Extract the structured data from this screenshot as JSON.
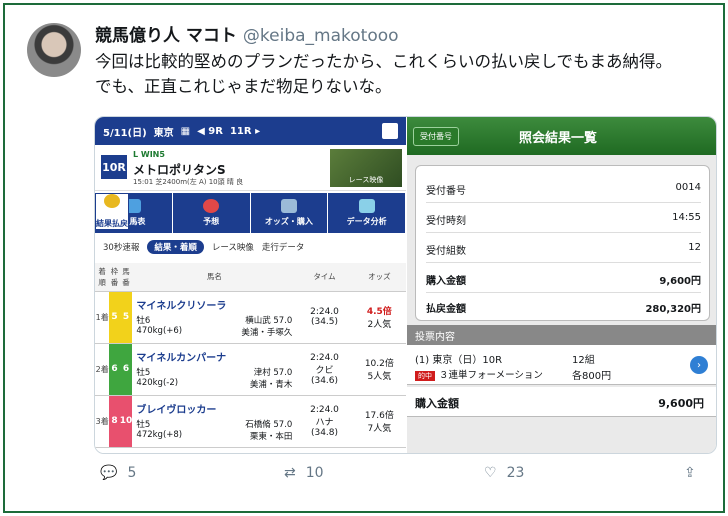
{
  "tweet": {
    "name": "競馬億り人 マコト",
    "handle": "@keiba_makotooo",
    "text_line1": "今回は比較的堅めのプランだったから、これくらいの払い戻しでもまあ納得。",
    "text_line2": "でも、正直これじゃまだ物足りないな。",
    "replies": "5",
    "retweets": "10",
    "likes": "23"
  },
  "left_panel": {
    "date": "5/11(日)",
    "venue": "東京",
    "race_prev": "◀ 9R",
    "race_next": "11R ▸",
    "race_no": "10R",
    "win5": "L  WIN5",
    "race_name": "メトロポリタンS",
    "race_sub": "15:01 芝2400m(左 A) 10頭 晴 良",
    "video_label": "レース映像",
    "icons": [
      "出馬表",
      "予想",
      "オッズ・購入",
      "データ分析",
      "結果払戻"
    ],
    "tabs": [
      "30秒速報",
      "結果・着順",
      "レース映像",
      "走行データ"
    ],
    "headers": [
      "着順",
      "枠番",
      "馬番",
      "馬名",
      "タイム",
      "オッズ"
    ],
    "rows": [
      {
        "fin": "1着",
        "waku": "5",
        "uma": "5",
        "name": "マイネルクリソーラ",
        "sex": "牡6",
        "jockey": "横山武 57.0",
        "weight": "470kg(+6)",
        "trainer": "美浦・手塚久",
        "time": "2:24.0",
        "margin": "",
        "last": "(34.5)",
        "odds": "4.5倍",
        "pop": "2人気",
        "color": "#f2d21b"
      },
      {
        "fin": "2着",
        "waku": "6",
        "uma": "6",
        "name": "マイネルカンパーナ",
        "sex": "牡5",
        "jockey": "津村 57.0",
        "weight": "420kg(-2)",
        "trainer": "美浦・青木",
        "time": "2:24.0",
        "margin": "クビ",
        "last": "(34.6)",
        "odds": "10.2倍",
        "pop": "5人気",
        "color": "#3fa63f"
      },
      {
        "fin": "3着",
        "waku": "8",
        "uma": "10",
        "name": "ブレイヴロッカー",
        "sex": "牡5",
        "jockey": "石橋脩 57.0",
        "weight": "472kg(+8)",
        "trainer": "栗東・本田",
        "time": "2:24.0",
        "margin": "ハナ",
        "last": "(34.8)",
        "odds": "17.6倍",
        "pop": "7人気",
        "color": "#e8506e"
      }
    ]
  },
  "right_panel": {
    "back": "受付番号",
    "title": "照会結果一覧",
    "items": [
      {
        "label": "受付番号",
        "value": "0014"
      },
      {
        "label": "受付時刻",
        "value": "14:55"
      },
      {
        "label": "受付組数",
        "value": "12"
      },
      {
        "label": "購入金額",
        "value": "9,600円"
      },
      {
        "label": "払戻金額",
        "value": "280,320円"
      }
    ],
    "ticket_header": "投票内容",
    "ticket_race": "(1)  東京（日）10R",
    "ticket_sets": "12組",
    "ticket_hit": "的中",
    "ticket_type": "３連単フォーメーション",
    "ticket_each": "各800円",
    "total_label": "購入金額",
    "total_value": "9,600円"
  }
}
